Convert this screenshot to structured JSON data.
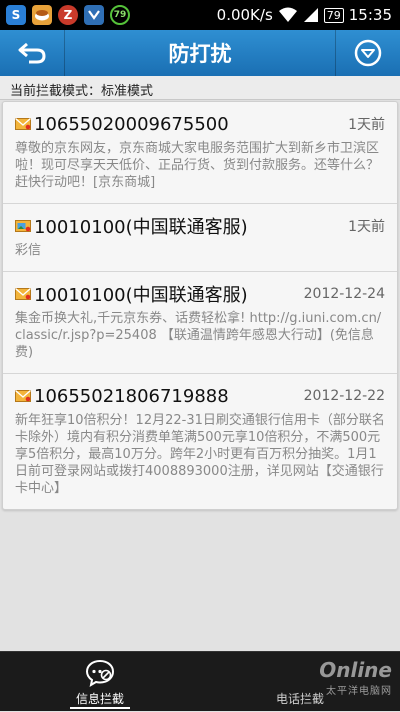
{
  "status_bar": {
    "icons": [
      "sim-icon",
      "game-icon",
      "z-app-icon",
      "cloud-icon",
      "timer-79-icon"
    ],
    "s_label": "S",
    "z_label": "Z",
    "timer_label": "79",
    "speed": "0.00K/s",
    "battery": "79",
    "time": "15:35"
  },
  "header": {
    "title": "防打扰"
  },
  "mode": {
    "text": "当前拦截模式：标准模式"
  },
  "messages": [
    {
      "sender": "10655020009675500",
      "time": "1天前",
      "preview": "尊敬的京东网友，京东商城大家电服务范围扩大到新乡市卫滨区啦！现可尽享天天低价、正品行货、货到付款服务。还等什么？赶快行动吧！[京东商城]",
      "icon": "sms-envelope-icon"
    },
    {
      "sender": "10010100(中国联通客服)",
      "time": "1天前",
      "preview": "彩信",
      "icon": "mms-envelope-icon"
    },
    {
      "sender": "10010100(中国联通客服)",
      "time": "2012-12-24",
      "preview": "集金币换大礼,千元京东券、话费轻松拿! http://g.iuni.com.cn/classic/r.jsp?p=25408 【联通温情跨年感恩大行动】(免信息费)",
      "icon": "sms-envelope-icon"
    },
    {
      "sender": "10655021806719888",
      "time": "2012-12-22",
      "preview": "新年狂享10倍积分！12月22-31日刷交通银行信用卡（部分联名卡除外）境内有积分消费单笔满500元享10倍积分，不满500元享5倍积分，最高10万分。跨年2小时更有百万积分抽奖。1月1日前可登录网站或拨打4008893000注册，详见网站【交通银行卡中心】",
      "icon": "sms-envelope-icon"
    }
  ],
  "bottom_nav": {
    "tabs": [
      {
        "label": "信息拦截",
        "active": true
      },
      {
        "label": "电话拦截",
        "active": false
      }
    ]
  },
  "watermark": {
    "brand": "Online",
    "sub": "太平洋电脑网"
  },
  "colors": {
    "header": "#1f7dc2",
    "bottom_nav": "#1b1b1b",
    "background": "#e2e2e2"
  }
}
